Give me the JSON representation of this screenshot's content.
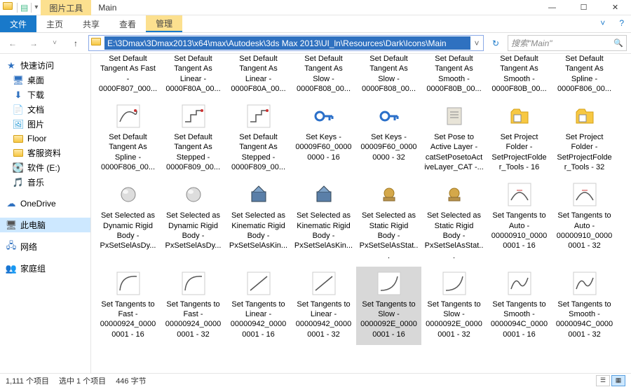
{
  "titlebar": {
    "context_tab": "图片工具",
    "title": "Main",
    "min": "—",
    "max": "☐",
    "close": "✕"
  },
  "ribbon": {
    "file": "文件",
    "tabs": [
      "主页",
      "共享",
      "查看",
      "管理"
    ],
    "help": "?"
  },
  "nav": {
    "back": "←",
    "fwd": "→",
    "dropdown": "˅",
    "up": "↑",
    "path": "E:\\3Dmax\\3Dmax2013\\x64\\max\\Autodesk\\3ds Max 2013\\UI_ln\\Resources\\Dark\\Icons\\Main",
    "addr_drop": "˅",
    "refresh": "↻",
    "search_placeholder": "搜索\"Main\"",
    "search_icon": "🔍"
  },
  "sidebar": {
    "quick": "快速访问",
    "items1": [
      {
        "icon": "🖥",
        "label": "桌面",
        "color": "#2f71c0"
      },
      {
        "icon": "⬇",
        "label": "下载",
        "color": "#2f71c0"
      },
      {
        "icon": "📄",
        "label": "文档",
        "color": "#6aa9e9"
      },
      {
        "icon": "🖼",
        "label": "图片",
        "color": "#37a2da"
      },
      {
        "icon": "",
        "label": "Floor",
        "color": "#f7c843",
        "folder": true
      },
      {
        "icon": "",
        "label": "客服资料",
        "color": "#f7c843",
        "folder": true
      },
      {
        "icon": "💽",
        "label": "软件 (E:)",
        "color": "#888"
      },
      {
        "icon": "🎵",
        "label": "音乐",
        "color": "#2f71c0"
      }
    ],
    "onedrive": {
      "icon": "☁",
      "label": "OneDrive"
    },
    "thispc": {
      "icon": "🖥",
      "label": "此电脑"
    },
    "network": {
      "icon": "🖧",
      "label": "网络"
    },
    "homegroup": {
      "icon": "👥",
      "label": "家庭组"
    }
  },
  "grid": {
    "row0": [
      {
        "l1": "Set Default",
        "l2": "Tangent As Fast",
        "l3": "-",
        "l4": "0000F807_000..."
      },
      {
        "l1": "Set Default",
        "l2": "Tangent As",
        "l3": "Linear -",
        "l4": "0000F80A_00..."
      },
      {
        "l1": "Set Default",
        "l2": "Tangent As",
        "l3": "Linear -",
        "l4": "0000F80A_00..."
      },
      {
        "l1": "Set Default",
        "l2": "Tangent As",
        "l3": "Slow -",
        "l4": "0000F808_00..."
      },
      {
        "l1": "Set Default",
        "l2": "Tangent As",
        "l3": "Slow -",
        "l4": "0000F808_00..."
      },
      {
        "l1": "Set Default",
        "l2": "Tangent As",
        "l3": "Smooth -",
        "l4": "0000F80B_00..."
      },
      {
        "l1": "Set Default",
        "l2": "Tangent As",
        "l3": "Smooth -",
        "l4": "0000F80B_00..."
      },
      {
        "l1": "Set Default",
        "l2": "Tangent As",
        "l3": "Spline -",
        "l4": "0000F806_00..."
      }
    ],
    "row1": [
      {
        "icon": "spline",
        "l1": "Set Default",
        "l2": "Tangent As",
        "l3": "Spline -",
        "l4": "0000F806_00..."
      },
      {
        "icon": "step",
        "l1": "Set Default",
        "l2": "Tangent As",
        "l3": "Stepped -",
        "l4": "0000F809_00..."
      },
      {
        "icon": "step",
        "l1": "Set Default",
        "l2": "Tangent As",
        "l3": "Stepped -",
        "l4": "0000F809_00..."
      },
      {
        "icon": "key",
        "l1": "Set Keys -",
        "l2": "00009F60_0000",
        "l3": "0000 - 16",
        "l4": ""
      },
      {
        "icon": "key",
        "l1": "Set Keys -",
        "l2": "00009F60_0000",
        "l3": "0000 - 32",
        "l4": ""
      },
      {
        "icon": "doc",
        "l1": "Set Pose to",
        "l2": "Active Layer -",
        "l3": "catSetPosetoAct",
        "l4": "iveLayer_CAT -..."
      },
      {
        "icon": "folder",
        "l1": "Set Project",
        "l2": "Folder -",
        "l3": "SetProjectFolde",
        "l4": "r_Tools - 16"
      },
      {
        "icon": "folder",
        "l1": "Set Project",
        "l2": "Folder -",
        "l3": "SetProjectFolde",
        "l4": "r_Tools - 32"
      }
    ],
    "row2": [
      {
        "icon": "ball",
        "l1": "Set Selected as",
        "l2": "Dynamic Rigid",
        "l3": "Body -",
        "l4": "PxSetSelAsDy..."
      },
      {
        "icon": "ball",
        "l1": "Set Selected as",
        "l2": "Dynamic Rigid",
        "l3": "Body -",
        "l4": "PxSetSelAsDy..."
      },
      {
        "icon": "kine",
        "l1": "Set Selected as",
        "l2": "Kinematic Rigid",
        "l3": "Body -",
        "l4": "PxSetSelAsKin..."
      },
      {
        "icon": "kine",
        "l1": "Set Selected as",
        "l2": "Kinematic Rigid",
        "l3": "Body -",
        "l4": "PxSetSelAsKin..."
      },
      {
        "icon": "stat",
        "l1": "Set Selected as",
        "l2": "Static Rigid",
        "l3": "Body -",
        "l4": "PxSetSelAsStat..."
      },
      {
        "icon": "stat",
        "l1": "Set Selected as",
        "l2": "Static Rigid",
        "l3": "Body -",
        "l4": "PxSetSelAsStat..."
      },
      {
        "icon": "auto",
        "l1": "Set Tangents to",
        "l2": "Auto -",
        "l3": "00000910_0000",
        "l4": "0001 - 16"
      },
      {
        "icon": "auto",
        "l1": "Set Tangents to",
        "l2": "Auto -",
        "l3": "00000910_0000",
        "l4": "0001 - 32"
      }
    ],
    "row3": [
      {
        "icon": "fast",
        "l1": "Set Tangents to",
        "l2": "Fast -",
        "l3": "00000924_0000",
        "l4": "0001 - 16"
      },
      {
        "icon": "fast",
        "l1": "Set Tangents to",
        "l2": "Fast -",
        "l3": "00000924_0000",
        "l4": "0001 - 32"
      },
      {
        "icon": "lin",
        "l1": "Set Tangents to",
        "l2": "Linear -",
        "l3": "00000942_0000",
        "l4": "0001 - 16"
      },
      {
        "icon": "lin",
        "l1": "Set Tangents to",
        "l2": "Linear -",
        "l3": "00000942_0000",
        "l4": "0001 - 32"
      },
      {
        "icon": "slow",
        "sel": true,
        "l1": "Set Tangents to",
        "l2": "Slow -",
        "l3": "0000092E_0000",
        "l4": "0001 - 16"
      },
      {
        "icon": "slow",
        "l1": "Set Tangents to",
        "l2": "Slow -",
        "l3": "0000092E_0000",
        "l4": "0001 - 32"
      },
      {
        "icon": "smooth",
        "l1": "Set Tangents to",
        "l2": "Smooth -",
        "l3": "0000094C_0000",
        "l4": "0001 - 16"
      },
      {
        "icon": "smooth",
        "l1": "Set Tangents to",
        "l2": "Smooth -",
        "l3": "0000094C_0000",
        "l4": "0001 - 32"
      }
    ]
  },
  "status": {
    "total": "1,111 个项目",
    "selected": "选中 1 个项目",
    "size": "446 字节"
  }
}
